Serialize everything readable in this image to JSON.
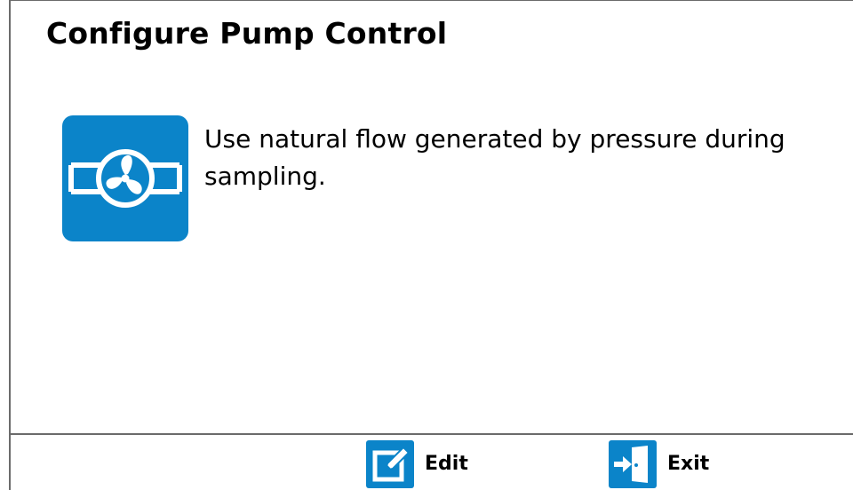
{
  "screen": {
    "title": "Configure Pump Control"
  },
  "mode": {
    "icon": "pump-fan-icon",
    "description": "Use natural flow generated by pressure during sampling."
  },
  "footer": {
    "buttons": [
      {
        "label": "Edit",
        "icon": "edit-icon"
      },
      {
        "label": "Exit",
        "icon": "exit-icon"
      }
    ]
  },
  "colors": {
    "accent": "#0b84c9",
    "border": "#6b6b6b",
    "background": "#ffffff",
    "text": "#000000"
  }
}
